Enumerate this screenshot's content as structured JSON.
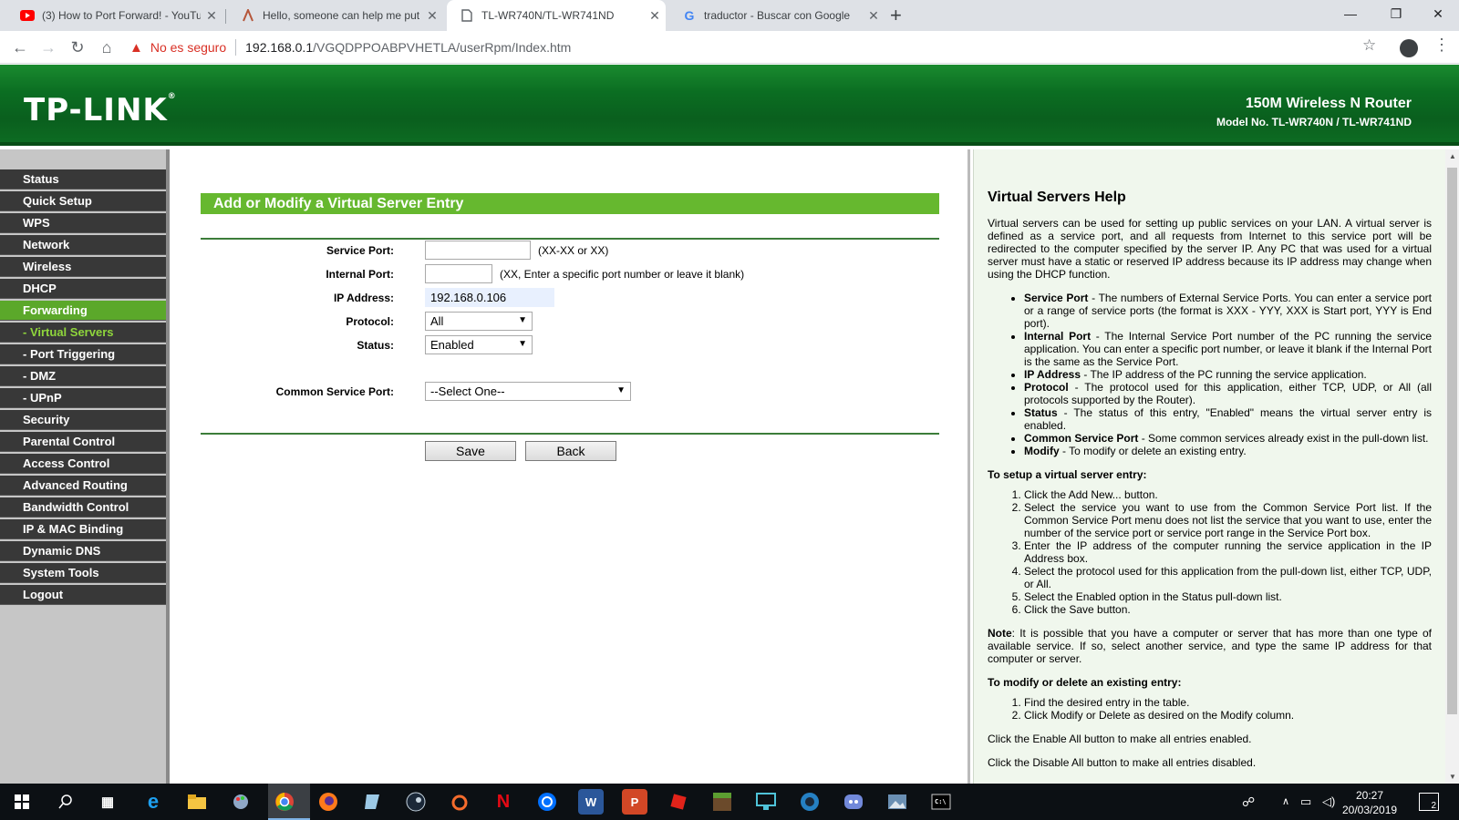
{
  "browser": {
    "tabs": [
      {
        "title": "(3) How to Port Forward! - YouTu",
        "icon": "youtube-icon"
      },
      {
        "title": "Hello, someone can help me put",
        "icon": "anthropic-icon"
      },
      {
        "title": "TL-WR740N/TL-WR741ND",
        "icon": "page-icon"
      },
      {
        "title": "traductor - Buscar con Google",
        "icon": "google-icon"
      }
    ],
    "active_tab": 2,
    "security_label": "No es seguro",
    "url_host": "192.168.0.1",
    "url_path": "/VGQDPPOABPVHETLA/userRpm/Index.htm"
  },
  "router": {
    "logo": "TP-LINK",
    "product_name": "150M Wireless N Router",
    "model": "Model No. TL-WR740N / TL-WR741ND",
    "menu": [
      {
        "label": "Status",
        "type": "main"
      },
      {
        "label": "Quick Setup",
        "type": "main"
      },
      {
        "label": "WPS",
        "type": "main"
      },
      {
        "label": "Network",
        "type": "main"
      },
      {
        "label": "Wireless",
        "type": "main"
      },
      {
        "label": "DHCP",
        "type": "main"
      },
      {
        "label": "Forwarding",
        "type": "active"
      },
      {
        "label": "- Virtual Servers",
        "type": "sub-active"
      },
      {
        "label": "- Port Triggering",
        "type": "sub"
      },
      {
        "label": "- DMZ",
        "type": "sub"
      },
      {
        "label": "- UPnP",
        "type": "sub"
      },
      {
        "label": "Security",
        "type": "main"
      },
      {
        "label": "Parental Control",
        "type": "main"
      },
      {
        "label": "Access Control",
        "type": "main"
      },
      {
        "label": "Advanced Routing",
        "type": "main"
      },
      {
        "label": "Bandwidth Control",
        "type": "main"
      },
      {
        "label": "IP & MAC Binding",
        "type": "main"
      },
      {
        "label": "Dynamic DNS",
        "type": "main"
      },
      {
        "label": "System Tools",
        "type": "main"
      },
      {
        "label": "Logout",
        "type": "main"
      }
    ],
    "form": {
      "heading": "Add or Modify a Virtual Server Entry",
      "service_port_label": "Service Port:",
      "service_port_value": "",
      "service_port_hint": "(XX-XX or XX)",
      "internal_port_label": "Internal Port:",
      "internal_port_value": "",
      "internal_port_hint": "(XX, Enter a specific port number or leave it blank)",
      "ip_label": "IP Address:",
      "ip_value": "192.168.0.106",
      "protocol_label": "Protocol:",
      "protocol_value": "All",
      "status_label": "Status:",
      "status_value": "Enabled",
      "common_label": "Common Service Port:",
      "common_value": "--Select One--",
      "save": "Save",
      "back": "Back"
    },
    "help": {
      "title": "Virtual Servers Help",
      "intro": "Virtual servers can be used for setting up public services on your LAN. A virtual server is defined as a service port, and all requests from Internet to this service port will be redirected to the computer specified by the server IP. Any PC that was used for a virtual server must have a static or reserved IP address because its IP address may change when using the DHCP function.",
      "definitions": [
        {
          "term": "Service Port",
          "text": " - The numbers of External Service Ports. You can enter a service port or a range of service ports (the format is XXX - YYY, XXX is Start port, YYY is End port)."
        },
        {
          "term": "Internal Port",
          "text": " - The Internal Service Port number of the PC running the service application. You can enter a specific port number, or leave it blank if the Internal Port is the same as the Service Port."
        },
        {
          "term": "IP Address",
          "text": " - The IP address of the PC running the service application."
        },
        {
          "term": "Protocol",
          "text": " - The protocol used for this application, either TCP, UDP, or All (all protocols supported by the Router)."
        },
        {
          "term": "Status",
          "text": " - The status of this entry, \"Enabled\" means the virtual server entry is enabled."
        },
        {
          "term": "Common Service Port",
          "text": " - Some common services already exist in the pull-down list."
        },
        {
          "term": "Modify",
          "text": " - To modify or delete an existing entry."
        }
      ],
      "setup_title": "To setup a virtual server entry:",
      "setup_steps": [
        "Click the Add New... button.",
        "Select the service you want to use from the Common Service Port list. If the Common Service Port menu does not list the service that you want to use, enter the number of the service port or service port range in the Service Port box.",
        "Enter the IP address of the computer running the service application in the IP Address box.",
        "Select the protocol used for this application from the pull-down list, either TCP, UDP, or All.",
        "Select the Enabled option in the Status pull-down list.",
        "Click the Save button."
      ],
      "note_term": "Note",
      "note_text": ": It is possible that you have a computer or server that has more than one type of available service. If so, select another service, and type the same IP address for that computer or server.",
      "modify_title": "To modify or delete an existing entry:",
      "modify_steps": [
        "Find the desired entry in the table.",
        "Click Modify or Delete as desired on the Modify column."
      ],
      "enable_all": "Click the Enable All button to make all entries enabled.",
      "disable_all": "Click the Disable All button to make all entries disabled."
    }
  },
  "taskbar": {
    "time": "20:27",
    "date": "20/03/2019",
    "notifications": "2",
    "colors": {
      "bg": "#0c1014",
      "accent": "#7fb3e6"
    }
  },
  "colors": {
    "banner": "#0b6e22",
    "menu_active": "#5ba82a",
    "form_header": "#66b82f",
    "help_bg": "#f0f7ed"
  }
}
